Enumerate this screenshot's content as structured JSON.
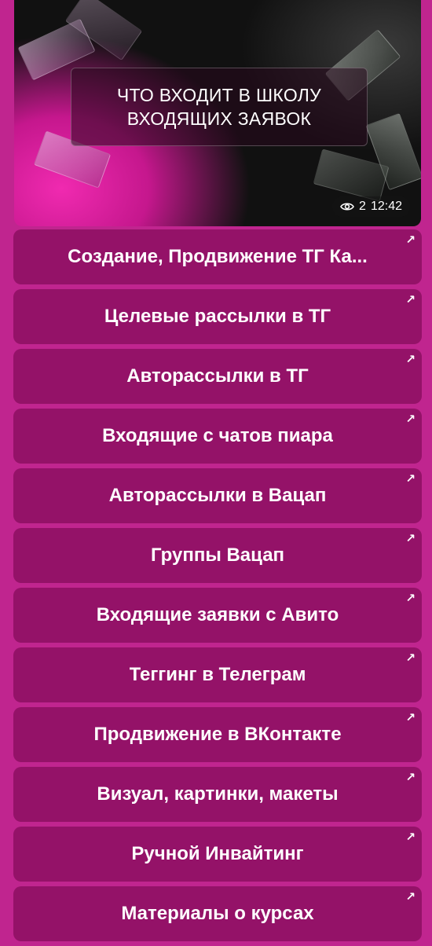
{
  "hero": {
    "title": "ЧТО ВХОДИТ В ШКОЛУ\nВХОДЯЩИХ ЗАЯВОК",
    "views": "2",
    "time": "12:42",
    "eye_icon": "eye-icon"
  },
  "menu": {
    "link_icon": "↗",
    "items": [
      {
        "label": "Создание, Продвижение ТГ Ка..."
      },
      {
        "label": "Целевые рассылки в ТГ"
      },
      {
        "label": "Авторассылки в ТГ"
      },
      {
        "label": "Входящие с чатов пиара"
      },
      {
        "label": "Авторассылки в Вацап"
      },
      {
        "label": "Группы Вацап"
      },
      {
        "label": "Входящие заявки с Авито"
      },
      {
        "label": "Теггинг в Телеграм"
      },
      {
        "label": "Продвижение в ВКонтакте"
      },
      {
        "label": "Визуал, картинки, макеты"
      },
      {
        "label": "Ручной Инвайтинг"
      },
      {
        "label": "Материалы о курсах"
      }
    ]
  },
  "colors": {
    "background": "#c0258f",
    "button": "#941268",
    "text": "#ffffff"
  }
}
